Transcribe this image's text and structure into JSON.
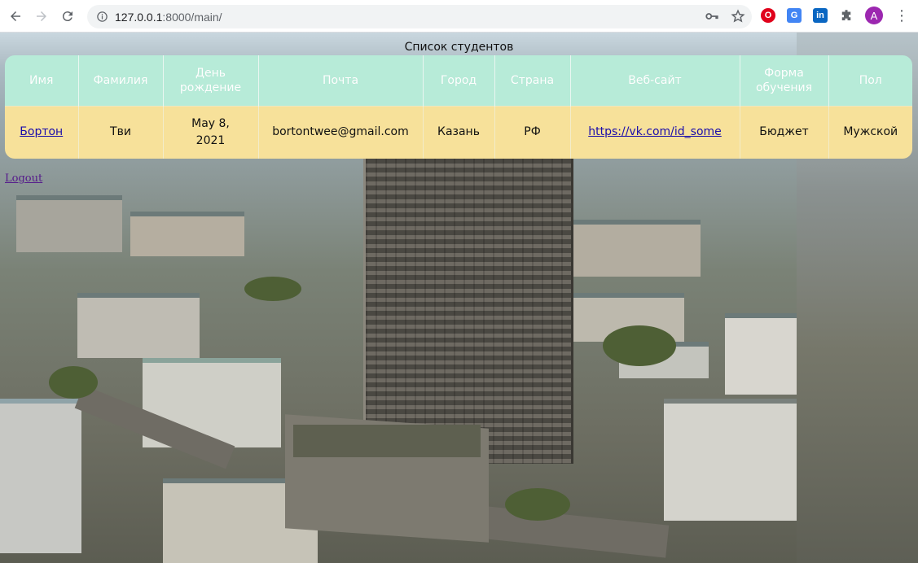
{
  "browser": {
    "url_host": "127.0.0.1",
    "url_rest": ":8000/main/",
    "avatar_letter": "A",
    "icons": [
      "back-arrow-icon",
      "forward-arrow-icon",
      "reload-icon",
      "info-icon",
      "key-icon",
      "star-icon",
      "opera-icon",
      "translate-icon",
      "linkedin-icon",
      "puzzle-icon",
      "menu-icon"
    ]
  },
  "page": {
    "title": "Список студентов",
    "logout_label": "Logout"
  },
  "table": {
    "headers": [
      "Имя",
      "Фамилия",
      "День рождение",
      "Почта",
      "Город",
      "Страна",
      "Веб-сайт",
      "Форма обучения",
      "Пол"
    ],
    "rows": [
      {
        "first_name": "Бортон",
        "last_name": "Тви",
        "birthday": "May 8, 2021",
        "email": "bortontwee@gmail.com",
        "city": "Казань",
        "country": "РФ",
        "website": "https://vk.com/id_some",
        "study_form": "Бюджет",
        "gender": "Мужской"
      }
    ]
  },
  "colors": {
    "header_bg": "#b7ebd8",
    "row_bg": "#f7e19a",
    "link": "#1a0dab"
  }
}
